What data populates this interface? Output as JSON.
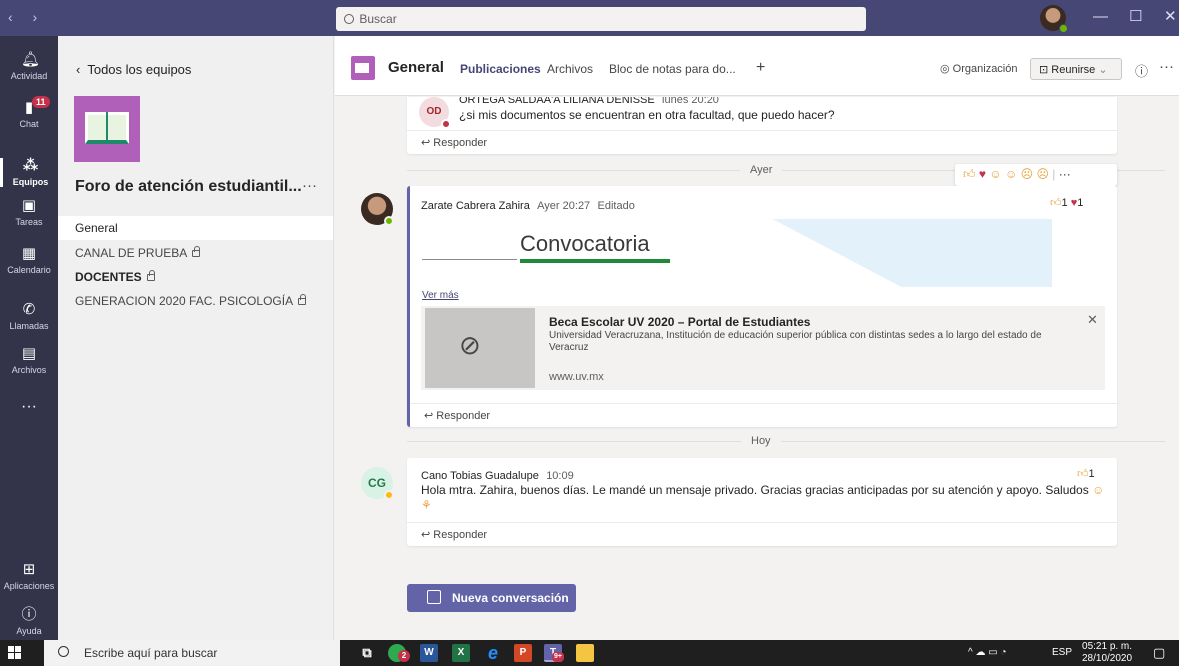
{
  "titlebar": {
    "search_placeholder": "Buscar"
  },
  "rail": {
    "items": [
      {
        "label": "Actividad",
        "icon": "bell-icon"
      },
      {
        "label": "Chat",
        "icon": "chat-icon",
        "badge": "11"
      },
      {
        "label": "Equipos",
        "icon": "teams-icon"
      },
      {
        "label": "Tareas",
        "icon": "tasks-icon"
      },
      {
        "label": "Calendario",
        "icon": "calendar-icon"
      },
      {
        "label": "Llamadas",
        "icon": "phone-icon"
      },
      {
        "label": "Archivos",
        "icon": "files-icon"
      }
    ],
    "more": "···",
    "apps": "Aplicaciones",
    "help": "Ayuda"
  },
  "sidebar": {
    "back_label": "Todos los equipos",
    "team_name": "Foro de atención estudiantil...",
    "team_more": "···",
    "channels": [
      {
        "label": "General"
      },
      {
        "label": "CANAL DE PRUEBA"
      },
      {
        "label": "DOCENTES"
      },
      {
        "label": "GENERACION 2020 FAC. PSICOLOGÍA"
      }
    ]
  },
  "header": {
    "channel_name": "General",
    "tabs": [
      "Publicaciones",
      "Archivos",
      "Bloc de notas para do...",
      "+"
    ],
    "org_label": "Organización",
    "meet_label": "Reunirse",
    "more": "···"
  },
  "feed": {
    "post1": {
      "initials": "OD",
      "author": "ORTEGA SALDAA'A LILIANA DENISSE",
      "time": "lunes 20:20",
      "text": "¿si mis documentos se encuentran en otra facultad, que puedo hacer?",
      "reply": "Responder"
    },
    "divider_ayer": "Ayer",
    "post2": {
      "author": "Zarate Cabrera Zahira",
      "time": "Ayer 20:27",
      "edited": "Editado",
      "like_count": "1",
      "heart_count": "1",
      "banner_text": "Convocatoria",
      "see_more": "Ver más",
      "link_title": "Beca Escolar UV 2020 – Portal de Estudiantes",
      "link_desc": "Universidad Veracruzana, Institución de educación superior pública con distintas sedes a lo largo del estado de Veracruz",
      "link_domain": "www.uv.mx",
      "reply": "Responder"
    },
    "divider_hoy": "Hoy",
    "post3": {
      "initials": "CG",
      "author": "Cano Tobias Guadalupe",
      "time": "10:09",
      "like_count": "1",
      "text": "Hola mtra. Zahira, buenos días. Le mandé un mensaje privado. Gracias gracias anticipadas por su atención y apoyo. Saludos",
      "reply": "Responder"
    },
    "compose_label": "Nueva conversación"
  },
  "taskbar": {
    "search_placeholder": "Escribe aquí para buscar",
    "teams_badge": "9+",
    "chrome_badge": "2",
    "lang": "ESP",
    "time": "05:21 p. m.",
    "date": "28/10/2020"
  },
  "colors": {
    "titlebar": "#464775",
    "rail": "#33344a",
    "accent": "#6264a7",
    "team_tile": "#b060b8"
  }
}
